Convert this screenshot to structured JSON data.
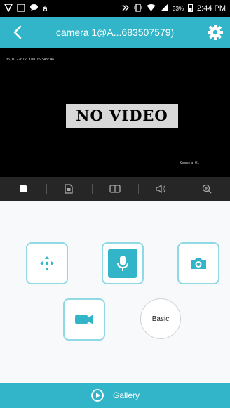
{
  "status_bar": {
    "icons_left": [
      "signal-alt-icon",
      "image-icon",
      "chat-icon",
      "amazon-icon"
    ],
    "icons_right": [
      "nfc-icon",
      "vibrate-icon",
      "wifi-icon",
      "cell-signal-icon"
    ],
    "battery": "33%",
    "time": "2:44 PM"
  },
  "header": {
    "title": "camera 1@A...683507579)",
    "bg_color": "#33b5c9"
  },
  "video": {
    "message": "NO VIDEO",
    "timestamp": "06-01-2017 Thu 09:45:46",
    "camera_label": "Camera 01"
  },
  "video_toolbar": {
    "icons": [
      "stop-icon",
      "sd-record-icon",
      "split-screen-icon",
      "volume-icon",
      "zoom-icon"
    ]
  },
  "controls": {
    "ptz_icon": "ptz-arrows-icon",
    "mic_icon": "microphone-icon",
    "snapshot_icon": "camera-icon",
    "record_icon": "video-camera-icon",
    "basic_label": "Basic",
    "accent_color": "#33b5c9"
  },
  "footer": {
    "gallery_label": "Gallery"
  }
}
